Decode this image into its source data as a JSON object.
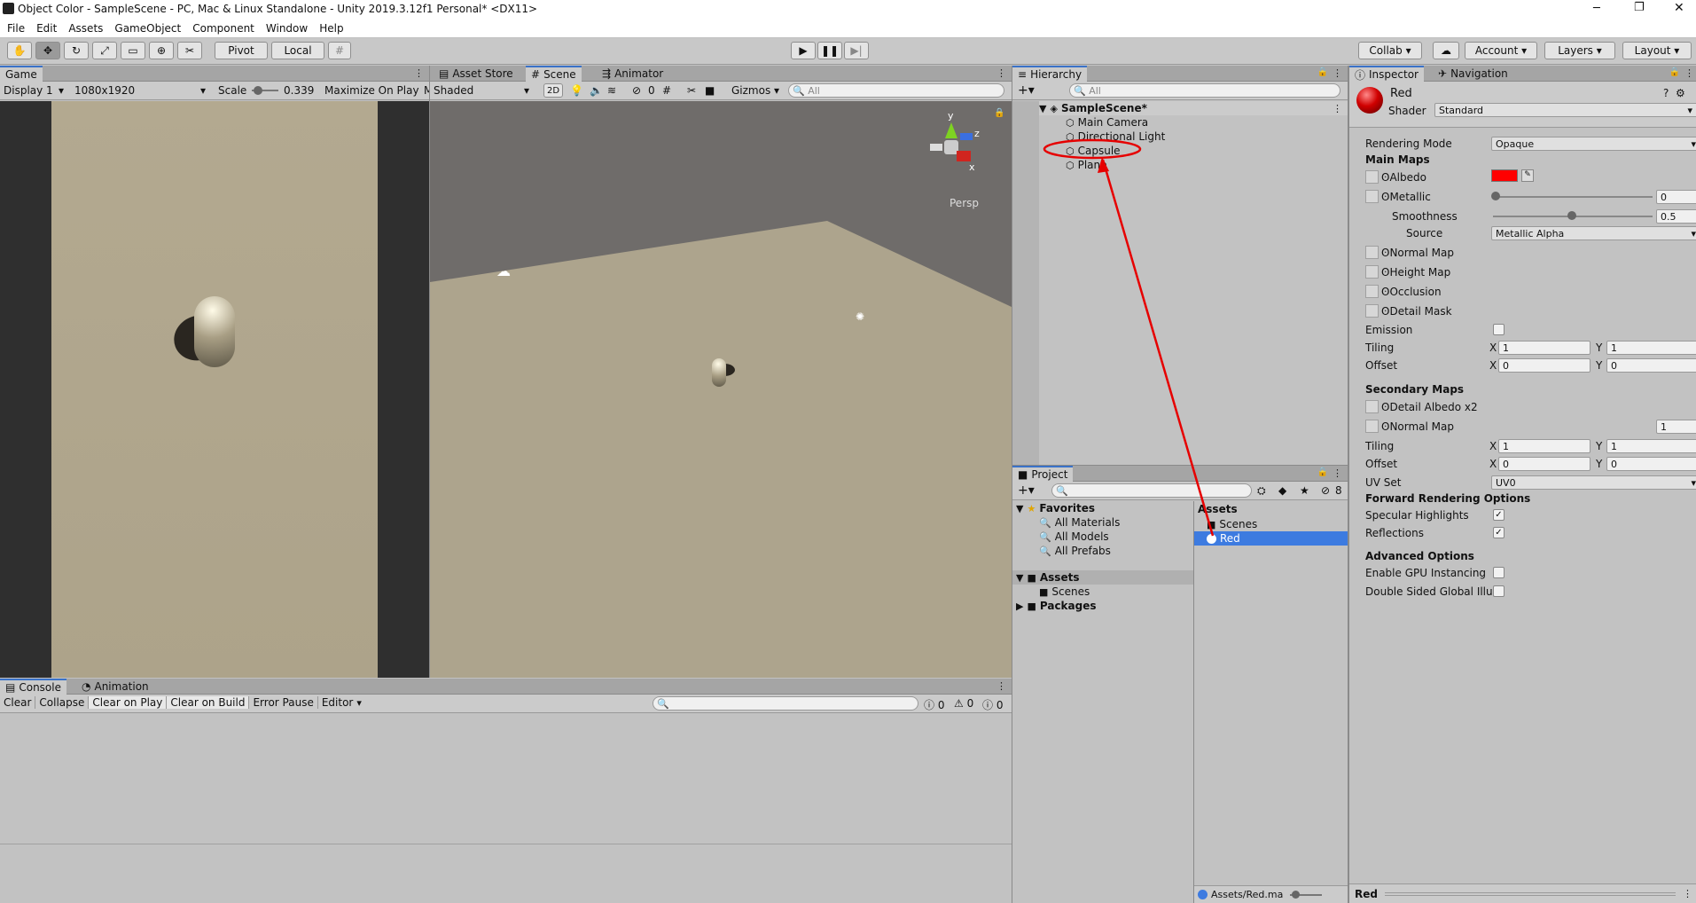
{
  "window": {
    "title": "Object Color - SampleScene - PC, Mac & Linux Standalone - Unity 2019.3.12f1 Personal* <DX11>"
  },
  "menu": [
    "File",
    "Edit",
    "Assets",
    "GameObject",
    "Component",
    "Window",
    "Help"
  ],
  "toolbar": {
    "pivot": "Pivot",
    "local": "Local",
    "collab": "Collab",
    "account": "Account",
    "layers": "Layers",
    "layout": "Layout"
  },
  "game": {
    "tab": "Game",
    "display": "Display 1",
    "resolution": "1080x1920",
    "scale_label": "Scale",
    "scale_value": "0.339",
    "maximize": "Maximize On Play",
    "m": "M"
  },
  "scene": {
    "tab_store": "Asset Store",
    "tab_scene": "Scene",
    "tab_animator": "Animator",
    "shading": "Shaded",
    "twoD": "2D",
    "hidden_count": "0",
    "gizmos": "Gizmos",
    "search_placeholder": "All",
    "persp": "Persp",
    "axis_y": "y",
    "axis_z": "z",
    "axis_x": "x"
  },
  "console": {
    "tab": "Console",
    "tab_anim": "Animation",
    "buttons": [
      "Clear",
      "Collapse",
      "Clear on Play",
      "Clear on Build",
      "Error Pause",
      "Editor"
    ],
    "counts": [
      "0",
      "0",
      "0"
    ]
  },
  "hierarchy": {
    "tab": "Hierarchy",
    "search_placeholder": "All",
    "scene": "SampleScene*",
    "items": [
      "Main Camera",
      "Directional Light",
      "Capsule",
      "Plane"
    ]
  },
  "project": {
    "tab": "Project",
    "hidden_count": "8",
    "favorites": "Favorites",
    "fav_items": [
      "All Materials",
      "All Models",
      "All Prefabs"
    ],
    "assets": "Assets",
    "scenes": "Scenes",
    "packages": "Packages",
    "right_header": "Assets",
    "right_items": [
      "Scenes",
      "Red"
    ],
    "footer": "Assets/Red.ma"
  },
  "inspector": {
    "tab": "Inspector",
    "tab_nav": "Navigation",
    "name": "Red",
    "shader_label": "Shader",
    "shader": "Standard",
    "rendering_mode_label": "Rendering Mode",
    "rendering_mode": "Opaque",
    "main_maps": "Main Maps",
    "albedo": "Albedo",
    "albedo_color": "#ff0000",
    "metallic": "Metallic",
    "metallic_value": "0",
    "smoothness": "Smoothness",
    "smoothness_value": "0.5",
    "source_label": "Source",
    "source": "Metallic Alpha",
    "normal_map": "Normal Map",
    "height_map": "Height Map",
    "occlusion": "Occlusion",
    "detail_mask": "Detail Mask",
    "emission": "Emission",
    "tiling": "Tiling",
    "offset": "Offset",
    "x": "X",
    "y": "Y",
    "tiling_x": "1",
    "tiling_y": "1",
    "offset_x": "0",
    "offset_y": "0",
    "secondary_maps": "Secondary Maps",
    "detail_albedo": "Detail Albedo x2",
    "normal_map2": "Normal Map",
    "normal_scale": "1",
    "tiling2_x": "1",
    "tiling2_y": "1",
    "offset2_x": "0",
    "offset2_y": "0",
    "uv_set_label": "UV Set",
    "uv_set": "UV0",
    "forward": "Forward Rendering Options",
    "specular": "Specular Highlights",
    "reflections": "Reflections",
    "advanced": "Advanced Options",
    "gpu": "Enable GPU Instancing",
    "double_sided": "Double Sided Global Illun",
    "footer": "Red"
  },
  "colors": {
    "accent": "#3a72c8",
    "annotation": "#e60000",
    "selection": "#3d7be0"
  }
}
